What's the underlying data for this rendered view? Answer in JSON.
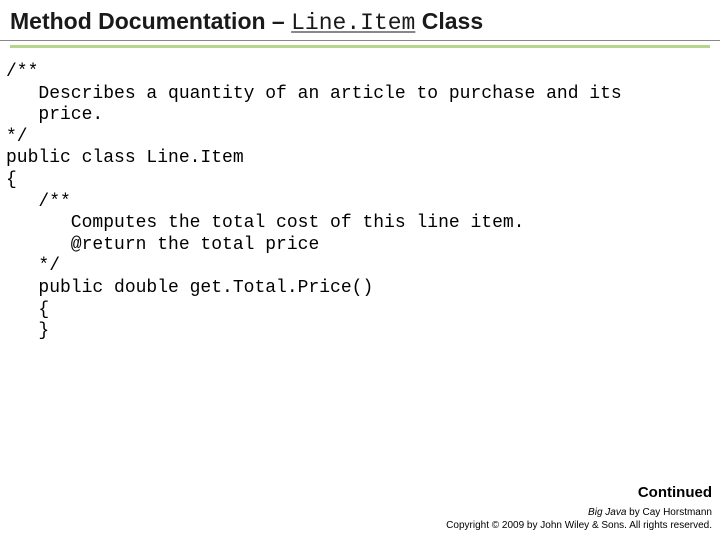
{
  "title": {
    "prefix": "Method Documentation – ",
    "code": "Line.Item",
    "suffix": " Class"
  },
  "code": "/**\n   Describes a quantity of an article to purchase and its\n   price.\n*/\npublic class Line.Item\n{\n   /**\n      Computes the total cost of this line item.\n      @return the total price\n   */\n   public double get.Total.Price()\n   {\n   }",
  "footer": {
    "continued": "Continued",
    "book": "Big Java",
    "byline": " by Cay Horstmann",
    "copyright": "Copyright © 2009 by John Wiley & Sons. All rights reserved."
  }
}
